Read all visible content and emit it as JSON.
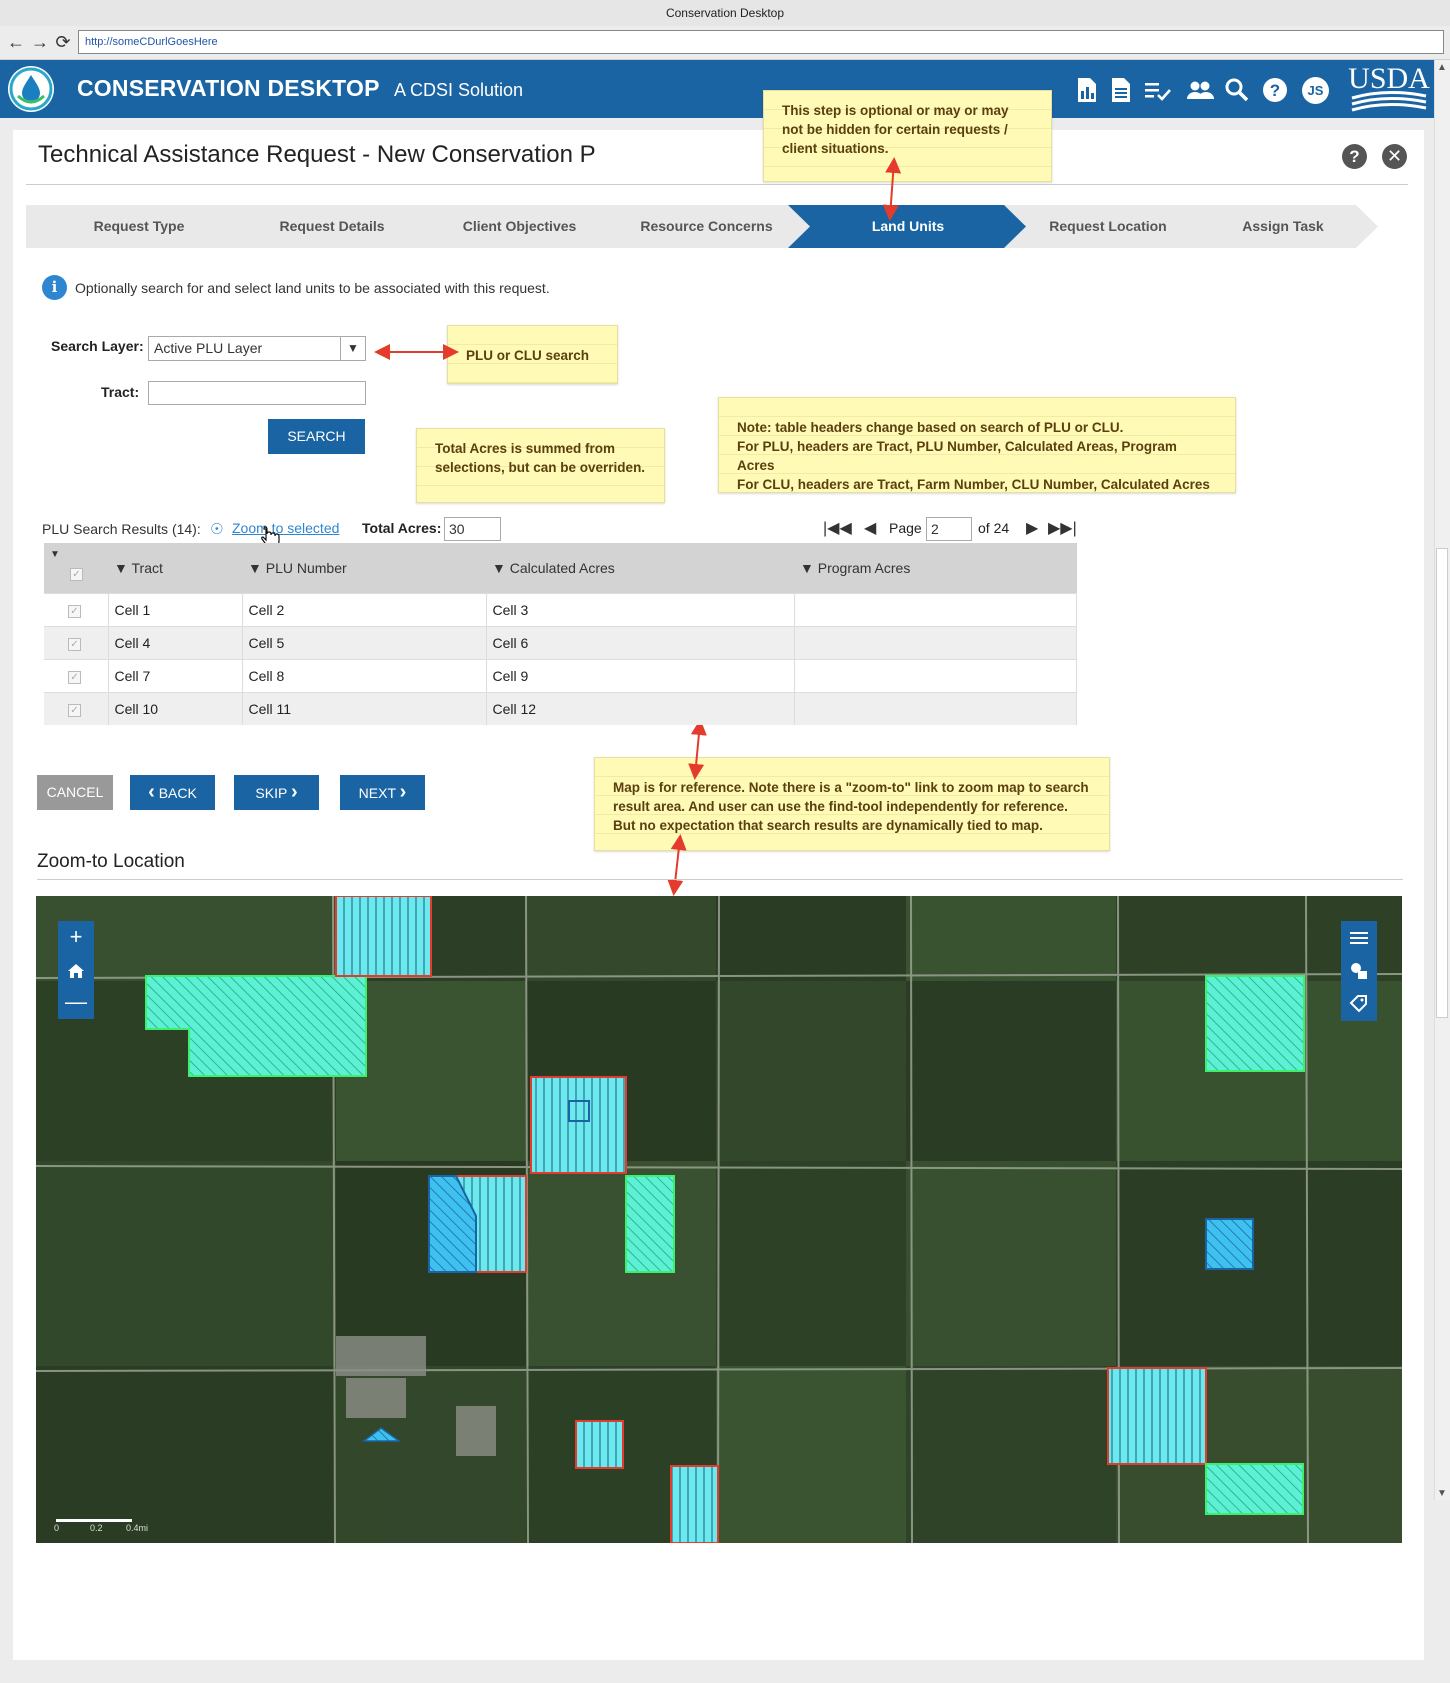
{
  "browser": {
    "title": "Conservation Desktop",
    "url": "http://someCDurlGoesHere"
  },
  "header": {
    "app_name": "CONSERVATION DESKTOP",
    "subtitle": "A CDSI Solution",
    "user_initials": "JS",
    "agency": "USDA"
  },
  "page": {
    "title": "Technical Assistance Request - New Conservation P"
  },
  "steps": [
    {
      "label": "Request Type",
      "active": false
    },
    {
      "label": "Request Details",
      "active": false
    },
    {
      "label": "Client Objectives",
      "active": false
    },
    {
      "label": "Resource Concerns",
      "active": false
    },
    {
      "label": "Land Units",
      "active": true
    },
    {
      "label": "Request Location",
      "active": false
    },
    {
      "label": "Assign Task",
      "active": false
    }
  ],
  "info": {
    "text": "Optionally search for and select land units to be associated with this request."
  },
  "form": {
    "search_layer_label": "Search Layer:",
    "search_layer_value": "Active PLU Layer",
    "tract_label": "Tract:",
    "tract_value": "",
    "search_button": "SEARCH"
  },
  "notes": {
    "optional_step": "This step is optional or may or may not be hidden for certain requests / client situations.",
    "plu_clu": "PLU or CLU search",
    "total_acres": "Total Acres is summed from selections, but can be overriden.",
    "table_headers_line1": "Note: table headers change based on search of PLU or CLU.",
    "table_headers_line2": "For PLU, headers are Tract, PLU Number, Calculated Areas, Program Acres",
    "table_headers_line3": "For CLU,  headers are Tract, Farm Number, CLU Number, Calculated Acres",
    "map_reference": "Map is for reference. Note there is a \"zoom-to\" link to zoom map to search result area. And user can use the find-tool independently for reference. But no expectation that search results are dynamically tied to map."
  },
  "results": {
    "title": "PLU Search Results (14):",
    "zoom_link": "Zoom to selected",
    "total_acres_label": "Total Acres:",
    "total_acres_value": "30",
    "page_label": "Page",
    "page_value": "2",
    "page_of": "of 24"
  },
  "table": {
    "columns": [
      "Tract",
      "PLU Number",
      "Calculated Acres",
      "Program Acres"
    ],
    "rows": [
      [
        "Cell 1",
        "Cell 2",
        "Cell 3",
        ""
      ],
      [
        "Cell 4",
        "Cell 5",
        "Cell 6",
        ""
      ],
      [
        "Cell 7",
        "Cell 8",
        "Cell 9",
        ""
      ],
      [
        "Cell 10",
        "Cell 11",
        "Cell 12",
        ""
      ]
    ]
  },
  "buttons": {
    "cancel": "CANCEL",
    "back": "BACK",
    "skip": "SKIP",
    "next": "NEXT"
  },
  "map": {
    "title": "Zoom-to Location",
    "scale_labels": [
      "0",
      "0.2",
      "0.4mi"
    ]
  },
  "colors": {
    "brand_blue": "#1a64a3",
    "note_yellow": "#fffab5",
    "arrow_red": "#e53b2c",
    "parcel_cyan": "#5fe8ee",
    "parcel_green": "#3df06a"
  }
}
